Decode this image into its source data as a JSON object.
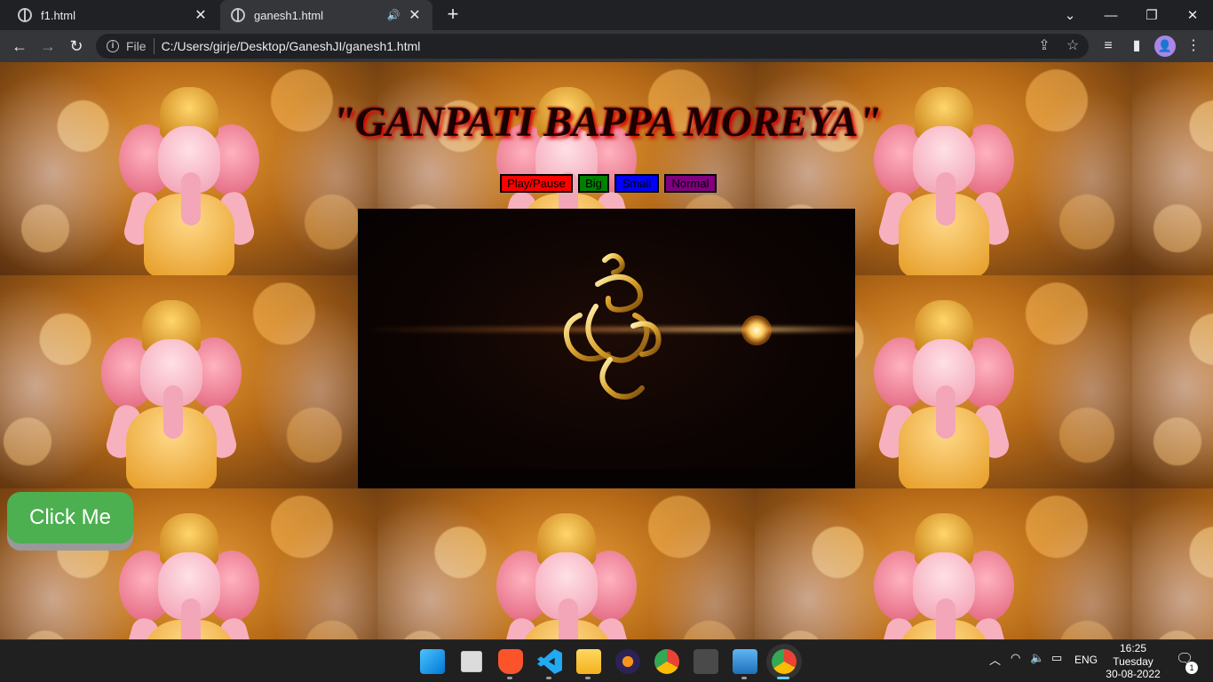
{
  "browser": {
    "tabs": [
      {
        "title": "f1.html",
        "active": false
      },
      {
        "title": "ganesh1.html",
        "active": true,
        "playing_audio": true
      }
    ],
    "url_scheme": "File",
    "url": "C:/Users/girje/Desktop/GaneshJI/ganesh1.html",
    "profile_initial": "👤"
  },
  "page": {
    "title": "\"GANPATI BAPPA MOREYA\"",
    "controls": {
      "play_pause": "Play/Pause",
      "big": "Big",
      "small": "Small",
      "normal": "Normal"
    },
    "click_button": "Click Me",
    "colors": {
      "play": "#ff0000",
      "big": "#008000",
      "small": "#0000ff",
      "normal": "#800080",
      "click_me": "#4caf50"
    }
  },
  "taskbar": {
    "language": "ENG",
    "time": "16:25",
    "day": "Tuesday",
    "date": "30-08-2022",
    "notification_count": "1"
  }
}
